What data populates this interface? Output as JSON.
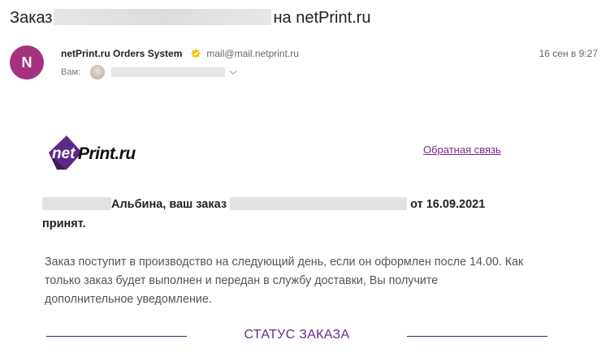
{
  "email": {
    "subject_prefix": "Заказ",
    "subject_suffix": "на netPrint.ru",
    "sender_initial": "N",
    "sender_name": "netPrint.ru Orders System",
    "sender_email": "mail@mail.netprint.ru",
    "date": "16 сен в 9:27",
    "to_label": "Вам:"
  },
  "body": {
    "logo_text": "Print.ru",
    "logo_badge": "net",
    "feedback_link": "Обратная связь",
    "headline_name": "Альбина, ваш заказ",
    "headline_date": "от 16.09.2021",
    "headline_status": "принят.",
    "paragraph": "Заказ поступит в производство на следующий день, если он оформлен после 14.00. Как только заказ будет выполнен и передан в службу доставки, Вы получите дополнительное уведомление.",
    "status_heading": "СТАТУС ЗАКАЗА"
  },
  "colors": {
    "avatar_bg": "#a5317f",
    "brand_purple": "#5b2a86",
    "link": "#7a2a8a"
  }
}
